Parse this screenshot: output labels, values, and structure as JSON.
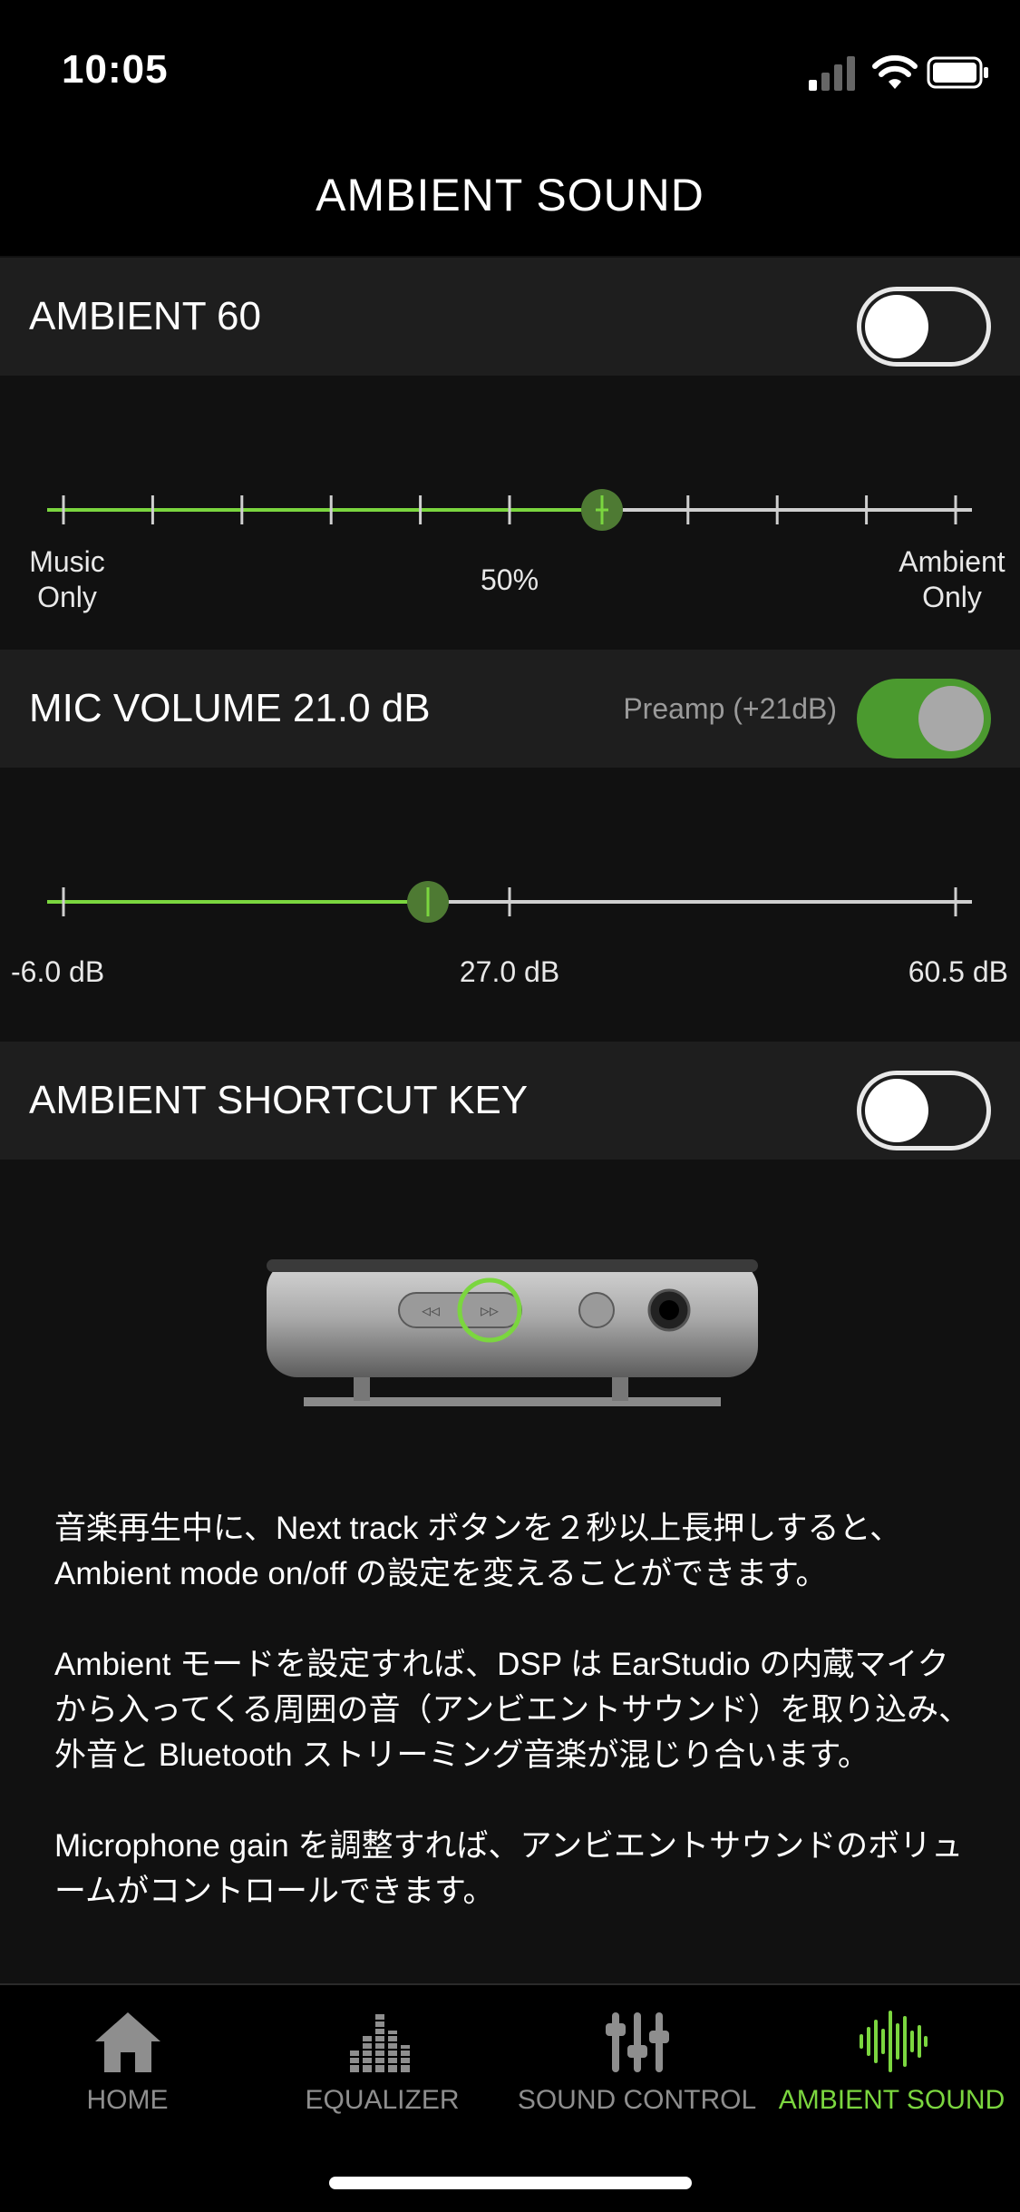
{
  "status": {
    "time": "10:05"
  },
  "header": {
    "title": "AMBIENT SOUND"
  },
  "ambient": {
    "label": "AMBIENT 60",
    "toggle_on": false,
    "slider_value_percent": 60,
    "tick_left": "Music Only",
    "tick_left_line1": "Music",
    "tick_left_line2": "Only",
    "tick_mid": "50%",
    "tick_right_line1": "Ambient",
    "tick_right_line2": "Only"
  },
  "mic": {
    "label": "MIC VOLUME 21.0 dB",
    "preamp_label": "Preamp (+21dB)",
    "preamp_on": true,
    "value_db": 21.0,
    "min_label": "-6.0 dB",
    "mid_label": "27.0 dB",
    "max_label": "60.5 dB"
  },
  "shortcut": {
    "label": "AMBIENT SHORTCUT KEY",
    "toggle_on": false
  },
  "description": {
    "p1": "音楽再生中に、Next track ボタンを２秒以上長押しすると、Ambient mode on/off の設定を変えることができます。",
    "p2": "Ambient モードを設定すれば、DSP は EarStudio の内蔵マイクから入ってくる周囲の音（アンビエントサウンド）を取り込み、外音と Bluetooth ストリーミング音楽が混じり合います。",
    "p3": "Microphone gain を調整すれば、アンビエントサウンドのボリュームがコントロールできます。"
  },
  "tabs": [
    {
      "label": "HOME",
      "icon": "home-icon",
      "active": false
    },
    {
      "label": "EQUALIZER",
      "icon": "equalizer-icon",
      "active": false
    },
    {
      "label": "SOUND CONTROL",
      "icon": "sliders-icon",
      "active": false
    },
    {
      "label": "AMBIENT SOUND",
      "icon": "sound-wave-icon",
      "active": true
    }
  ],
  "colors": {
    "accent": "#7bd63f",
    "toggle_on": "#4b9a2f",
    "background": "#111111",
    "row_background": "#1e1e1e"
  }
}
